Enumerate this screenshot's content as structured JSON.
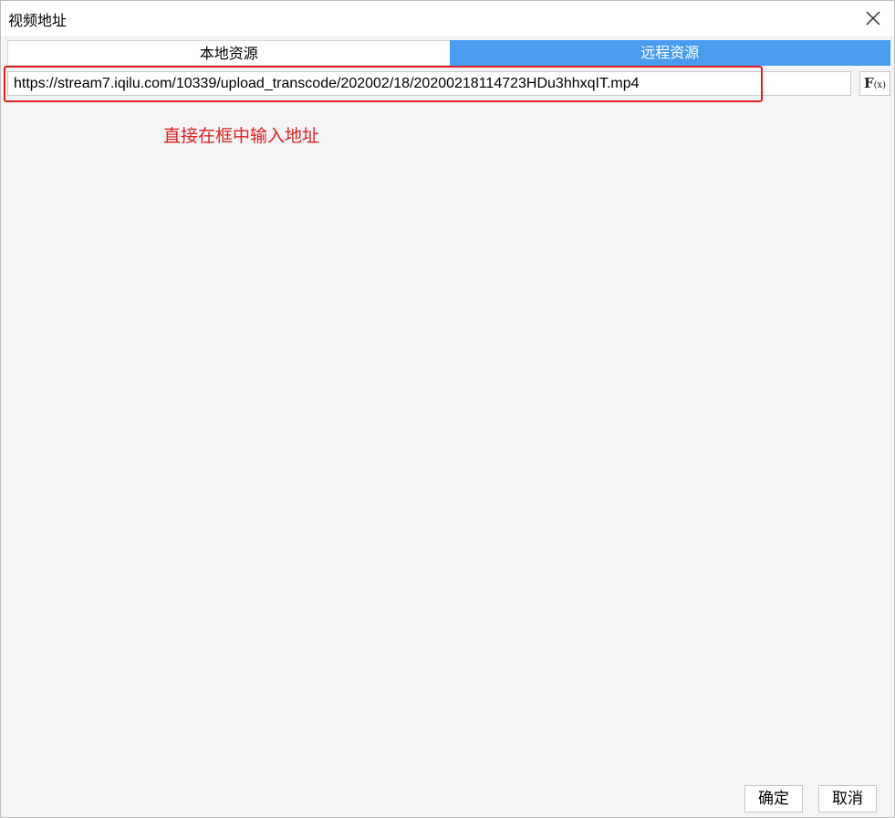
{
  "window": {
    "title": "视频地址",
    "close_icon": "close-icon"
  },
  "tabs": [
    {
      "label": "本地资源",
      "active": false
    },
    {
      "label": "远程资源",
      "active": true
    }
  ],
  "url_field": {
    "value": "https://stream7.iqilu.com/10339/upload_transcode/202002/18/20200218114723HDu3hhxqIT.mp4",
    "formula_button": "F(x)"
  },
  "annotation": {
    "text": "直接在框中输入地址",
    "color": "#e02020"
  },
  "buttons": {
    "ok": "确定",
    "cancel": "取消"
  },
  "colors": {
    "active_tab": "#4a9cf1",
    "highlight": "#e02020",
    "background": "#f4f4f6"
  }
}
